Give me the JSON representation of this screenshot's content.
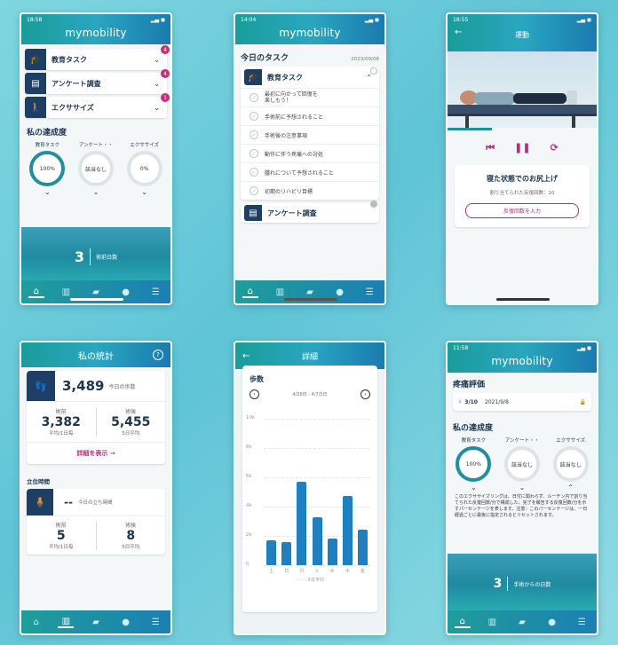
{
  "brand": "mymobility",
  "screens": {
    "home": {
      "status_time": "18:58",
      "status_icons": "▂▄ ◼",
      "accordions": [
        {
          "label": "教育タスク",
          "badge": "4"
        },
        {
          "label": "アンケート調査",
          "badge": "4"
        },
        {
          "label": "エクササイズ",
          "badge": "1"
        }
      ],
      "progress_title": "私の達成度",
      "rings": [
        {
          "label": "教育タスク",
          "value": "100%"
        },
        {
          "label": "アンケート・・",
          "value": "該当なし"
        },
        {
          "label": "エクササイズ",
          "value": "0%"
        }
      ],
      "days_number": "3",
      "days_label": "術前日数"
    },
    "tasks": {
      "status_time": "14:04",
      "status_icons": "▂▄ ◼",
      "title": "今日のタスク",
      "date": "2023/09/08",
      "section": "教育タスク",
      "items": [
        "最初に向かって回復を楽しもう！",
        "手術前に予想されること",
        "手術後の注意事項",
        "動作に伴う疼痛への対処",
        "腫れについて予想されること",
        "初期のリハビリ目標"
      ],
      "next_section": "アンケート調査"
    },
    "exercise": {
      "status_time": "18:55",
      "status_icons": "▂▄ ◼",
      "title": "運動",
      "exercise_name": "寝た状態でのお尻上げ",
      "reps": "割り当てられた反復回数：10",
      "button": "反復回数を入力"
    },
    "stats": {
      "title": "私の統計",
      "steps_today": "3,489",
      "steps_today_label": "今日の歩数",
      "before_label": "術前",
      "before_value": "3,382",
      "before_sub": "平均/1日毎",
      "after_label": "術後",
      "after_value": "5,455",
      "after_sub": "5日平均",
      "detail_link": "詳細を表示 →",
      "standing_title": "立位時間",
      "standing_value": "--",
      "standing_label": "今日の立ち時間",
      "st_before_label": "術前",
      "st_before_value": "5",
      "st_before_sub": "平均/1日毎",
      "st_after_label": "術後",
      "st_after_value": "8",
      "st_after_sub": "5日平均"
    },
    "detail": {
      "title": "詳細",
      "chart_title": "歩数",
      "range": "4/28日 - 4/7/5日"
    },
    "pain": {
      "status_time": "11:58",
      "status_icons": "▂▄ ◼",
      "section": "疼痛評価",
      "score": "3/10",
      "date": "2021/9/8",
      "progress_title": "私の達成度",
      "rings": [
        {
          "label": "教育タスク",
          "value": "100%"
        },
        {
          "label": "アンケート・・",
          "value": "該当なし"
        },
        {
          "label": "エクササイズ",
          "value": "該当なし"
        }
      ],
      "note": "このエクササイズリングは、日付に関わらず、ルーチン内で割り当てられた反復回数/分で構成した、完了を報告する反復回数/分を示すパーセンテージを表します。注意：このパーセンテージは、一日経過ごとに最後に指定されるとリセットされます。",
      "days_number": "3",
      "days_label": "手術からの日数"
    }
  },
  "chart_data": {
    "type": "bar",
    "title": "歩数",
    "categories": [
      "土",
      "日",
      "月",
      "火",
      "水",
      "木",
      "金"
    ],
    "values": [
      1700,
      1600,
      5700,
      3300,
      1800,
      4700,
      2400
    ],
    "ylim": [
      0,
      10000
    ],
    "yticks": [
      "10k",
      "8k",
      "6k",
      "4k",
      "2k",
      "0"
    ],
    "xlabel": "- - - - 5日平均",
    "color": "#1f7fbf"
  },
  "colors": {
    "accent": "#1f8fa0",
    "navy": "#1d3f66",
    "magenta": "#c2307a"
  }
}
